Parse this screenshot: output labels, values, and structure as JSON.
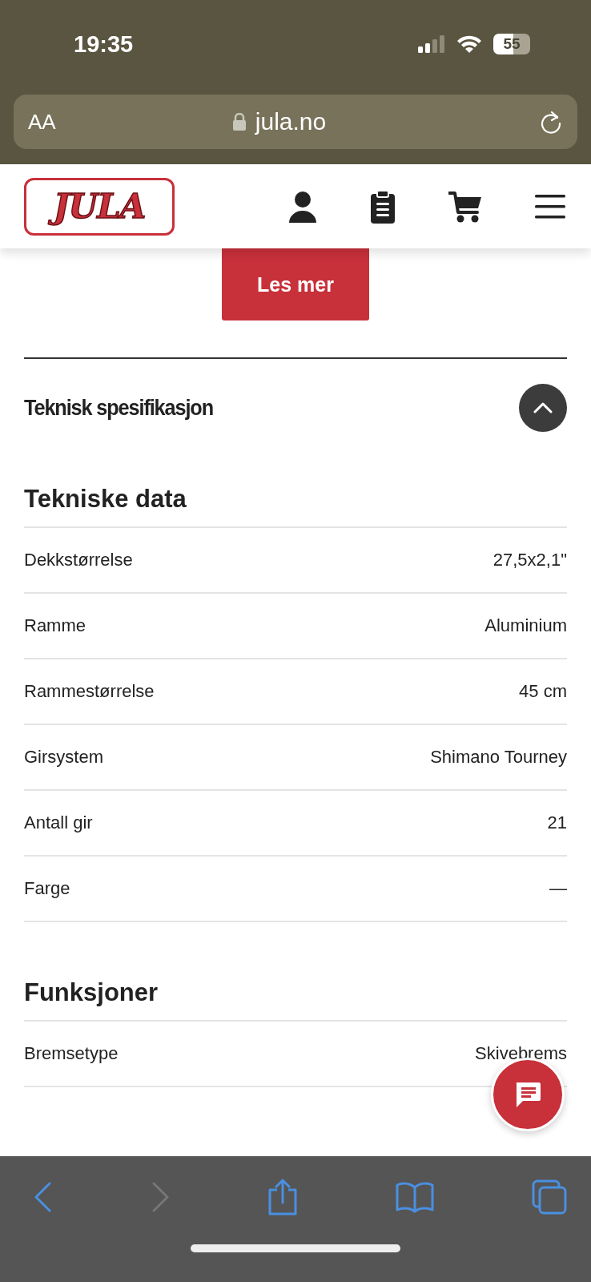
{
  "status_bar": {
    "time": "19:35",
    "battery": "55"
  },
  "address_bar": {
    "text_size_button": "AA",
    "url": "jula.no"
  },
  "header": {
    "logo": "JULA"
  },
  "read_more_button": "Les mer",
  "accordion": {
    "title": "Teknisk spesifikasjon",
    "expanded": true
  },
  "sections": [
    {
      "title": "Tekniske data",
      "rows": [
        {
          "label": "Dekkstørrelse",
          "value": "27,5x2,1\""
        },
        {
          "label": "Ramme",
          "value": "Aluminium"
        },
        {
          "label": "Rammestørrelse",
          "value": "45 cm"
        },
        {
          "label": "Girsystem",
          "value": "Shimano Tourney"
        },
        {
          "label": "Antall gir",
          "value": "21"
        },
        {
          "label": "Farge",
          "value": "—"
        }
      ]
    },
    {
      "title": "Funksjoner",
      "rows": [
        {
          "label": "Bremsetype",
          "value": "Skivebrems"
        }
      ]
    }
  ]
}
